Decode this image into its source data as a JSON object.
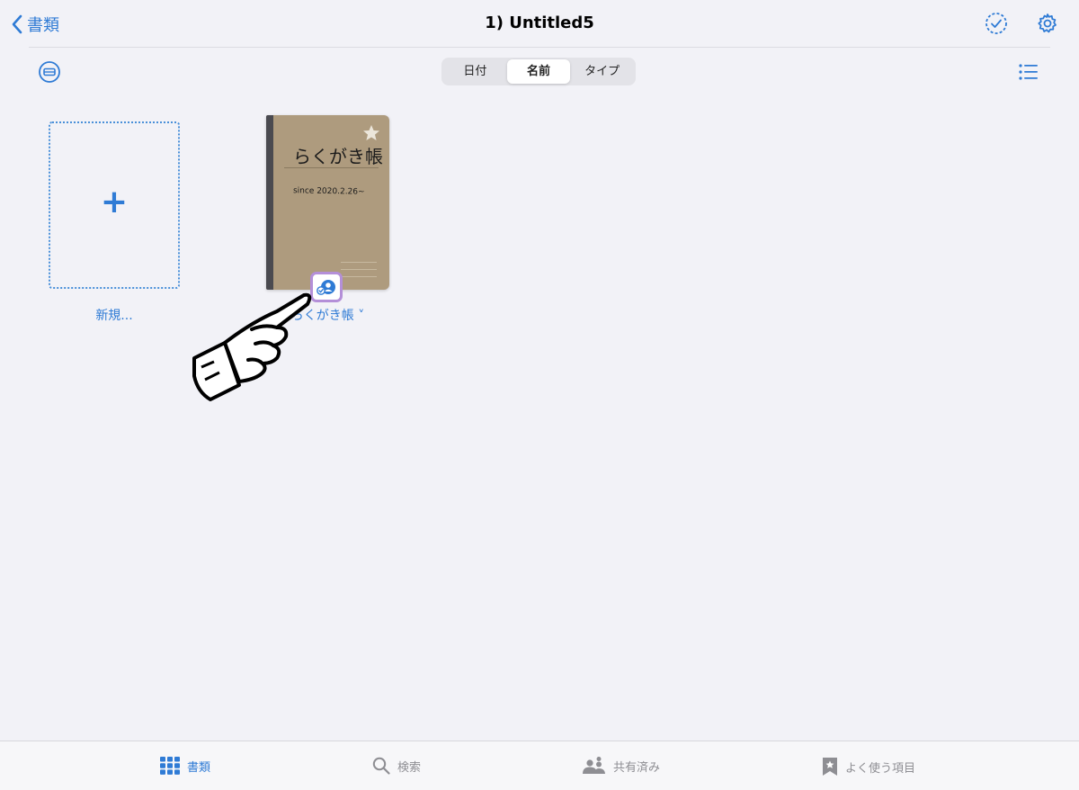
{
  "nav": {
    "back_label": "書類",
    "title": "1) Untitled5"
  },
  "toolbar": {
    "sort_options": [
      "日付",
      "名前",
      "タイプ"
    ],
    "selected_sort": "名前"
  },
  "documents": {
    "new_label": "新規...",
    "items": [
      {
        "name": "らくがき帳 ˅",
        "cover_title": "らくがき帳",
        "cover_subtitle": "since 2020.2.26~"
      }
    ]
  },
  "tabbar": {
    "items": [
      {
        "label": "書類",
        "icon": "grid-icon",
        "active": true
      },
      {
        "label": "検索",
        "icon": "search-icon",
        "active": false
      },
      {
        "label": "共有済み",
        "icon": "people-icon",
        "active": false
      },
      {
        "label": "よく使う項目",
        "icon": "bookmark-star-icon",
        "active": false
      }
    ]
  },
  "colors": {
    "accent": "#2f7bd5",
    "background": "#f2f2f7",
    "notebook_cover": "#ae9b7e",
    "badge_border": "#b48fd8"
  }
}
